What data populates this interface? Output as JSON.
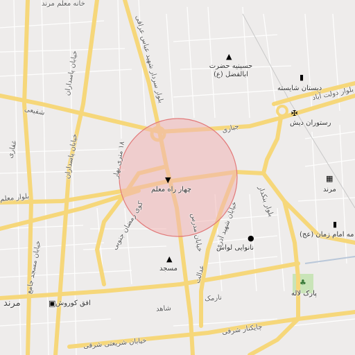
{
  "map": {
    "colors": {
      "background": "#eeeceb",
      "major_road": "#f6d77a",
      "minor_road": "#ffffff",
      "park": "#c9e4b8",
      "highlight_fill": "#f1b4b4",
      "highlight_stroke": "#e27979"
    },
    "pois": [
      {
        "name": "hosseinieh",
        "label": "حسینیه حضرت ابالفضل (ع)",
        "icon": "mosque-icon"
      },
      {
        "name": "school-shayesteh",
        "label": "دبستان شایسته",
        "icon": "school-icon"
      },
      {
        "name": "restaurant-dish",
        "label": "رستوران دیش",
        "icon": "restaurant-icon"
      },
      {
        "name": "chahar-rah-moalem",
        "label": "چهار راه معلم",
        "icon": "intersection-pin-icon"
      },
      {
        "name": "bakery-lavash",
        "label": "نانوایی لواش",
        "icon": "bakery-icon"
      },
      {
        "name": "mosque",
        "label": "مسجد",
        "icon": "mosque-icon"
      },
      {
        "name": "park-laleh",
        "label": "پارک لاله",
        "icon": "park-icon"
      },
      {
        "name": "ofogh-kourosh",
        "label": "افق کوروش",
        "icon": "shop-icon"
      },
      {
        "name": "marand-station",
        "label": "مرند",
        "icon": "train-icon"
      },
      {
        "name": "school-imam",
        "label": "مه امام زمان (عج)",
        "icon": "school-icon"
      }
    ],
    "street_labels": {
      "moalem": "بلوار معلم",
      "shafiei": "شفیعی",
      "jomhuri": "جمهوری",
      "pasdaran": "خیابان پاسداران",
      "pasdaran2": "خیابان پاسداران",
      "abbas_eraghi": "بلوار سردار شهید عباس عراقی",
      "modarres": "خیابان مدرس",
      "shahid_azari": "خیابان شهید آذری",
      "bonakdar": "بلوار بنکدار",
      "jebari": "جباری",
      "dolat_abad": "بلوار دولت آباد",
      "adalat": "عدالت",
      "shahed": "شاهد",
      "narmak": "نارمک",
      "chaykenar": "چایکنار شرقی",
      "sharifi": "خیابان شریعتی شرقی",
      "ramezan": "کوی رمضان جنوبی",
      "mosque_jame": "خیابان مسجد جامع",
      "bahar": "۱۸ متری بهار",
      "ghaffari": "غفاری",
      "khaneh_moalem": "خانه معلم مرند",
      "nashrie": "دیش",
      "marand_city": "مرند"
    }
  }
}
